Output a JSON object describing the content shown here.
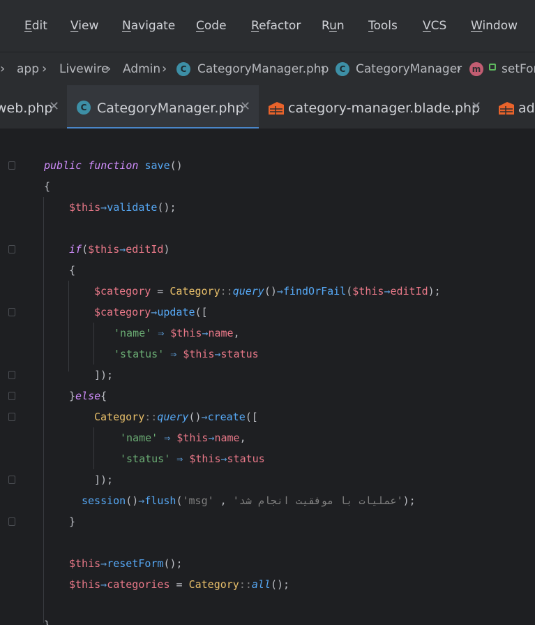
{
  "menu": {
    "items": [
      {
        "label": "Edit"
      },
      {
        "label": "View"
      },
      {
        "label": "Navigate"
      },
      {
        "label": "Code"
      },
      {
        "label": "Refactor"
      },
      {
        "label": "Run"
      },
      {
        "label": "Tools"
      },
      {
        "label": "VCS"
      },
      {
        "label": "Window"
      }
    ]
  },
  "breadcrumb": {
    "items": [
      "app",
      "Livewire",
      "Admin",
      "CategoryManager.php",
      "CategoryManager",
      "setFor"
    ]
  },
  "tabs": [
    {
      "label": "web.php"
    },
    {
      "label": "CategoryManager.php"
    },
    {
      "label": "category-manager.blade.php"
    },
    {
      "label": "adm"
    }
  ],
  "code": {
    "l1": {
      "a": "public",
      "b": " ",
      "c": "function",
      "d": " ",
      "e": "save",
      "f": "()"
    },
    "l2": "{",
    "l3": {
      "a": "$this",
      "b": "→",
      "c": "validate",
      "d": "();"
    },
    "l5": {
      "a": "if",
      "b": "(",
      "c": "$this",
      "d": "→",
      "e": "editId",
      "f": ")"
    },
    "l6": "{",
    "l7": {
      "a": "$category",
      "b": " = ",
      "c": "Category",
      "d": "::",
      "e": "query",
      "f": "()",
      "g": "→",
      "h": "findOrFail",
      "i": "(",
      "j": "$this",
      "k": "→",
      "l": "editId",
      "m": ");"
    },
    "l8": {
      "a": "$category",
      "b": "→",
      "c": "update",
      "d": "(["
    },
    "l9": {
      "a": "'name'",
      "b": " ⇒ ",
      "c": "$this",
      "d": "→",
      "e": "name",
      "f": ","
    },
    "l10": {
      "a": "'status'",
      "b": " ⇒ ",
      "c": "$this",
      "d": "→",
      "e": "status"
    },
    "l11": "]);",
    "l12": {
      "a": "}",
      "b": "else",
      "c": "{"
    },
    "l13": {
      "a": "Category",
      "b": "::",
      "c": "query",
      "d": "()",
      "e": "→",
      "f": "create",
      "g": "(["
    },
    "l14": {
      "a": "'name'",
      "b": " ⇒ ",
      "c": "$this",
      "d": "→",
      "e": "name",
      "f": ","
    },
    "l15": {
      "a": "'status'",
      "b": " ⇒ ",
      "c": "$this",
      "d": "→",
      "e": "status"
    },
    "l16": "]);",
    "l17": {
      "a": "session",
      "b": "()",
      "c": "→",
      "d": "flush",
      "e": "(",
      "f": "'msg'",
      "g": " , ",
      "h": "'عملیات با موفقیت انجام شد'",
      "i": ");"
    },
    "l18": "}",
    "l20": {
      "a": "$this",
      "b": "→",
      "c": "resetForm",
      "d": "();"
    },
    "l21": {
      "a": "$this",
      "b": "→",
      "c": "categories",
      "d": " = ",
      "e": "Category",
      "f": "::",
      "g": "all",
      "h": "();"
    },
    "l23": "}"
  },
  "colors": {
    "keyword": "#cf8dfb",
    "function": "#56a8f5",
    "variable": "#e87888",
    "class": "#e8bf6a",
    "string": "#6aab73",
    "tab_underline": "#4a86c8"
  }
}
